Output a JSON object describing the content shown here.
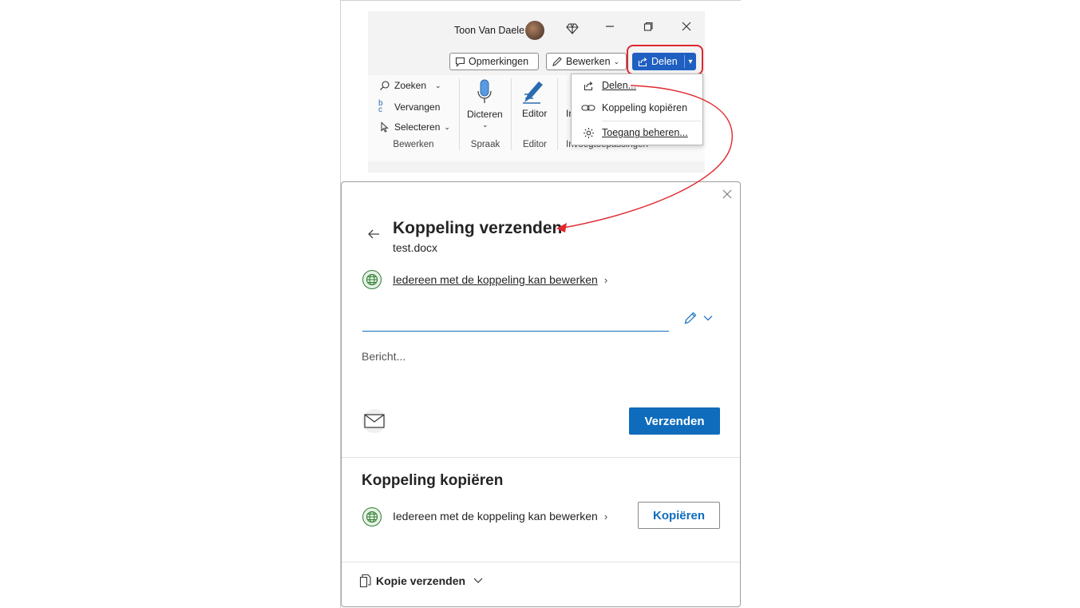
{
  "titlebar": {
    "user_name": "Toon Van Daele",
    "icons": [
      "diamond-icon",
      "minimize-icon",
      "restore-icon",
      "close-icon"
    ]
  },
  "toolbar": {
    "comments_label": "Opmerkingen",
    "editing_label": "Bewerken",
    "share_label": "Delen"
  },
  "ribbon": {
    "find_label": "Zoeken",
    "replace_label": "Vervangen",
    "select_label": "Selecteren",
    "group_editing": "Bewerken",
    "dictate_label": "Dicteren",
    "group_voice": "Spraak",
    "editor_label": "Editor",
    "group_editor": "Editor",
    "addins_partial": "In",
    "group_addins": "Invoegtoepassingen"
  },
  "share_menu": {
    "items": [
      {
        "label": "Delen...",
        "icon": "share-icon"
      },
      {
        "label": "Koppeling kopiëren",
        "icon": "link-icon"
      },
      {
        "label": "Toegang beheren...",
        "icon": "gear-icon"
      }
    ]
  },
  "dialog": {
    "title": "Koppeling verzenden",
    "filename": "test.docx",
    "permission_link": "Iedereen met de koppeling kan bewerken",
    "recipient_placeholder": "",
    "message_placeholder": "Bericht...",
    "send_button": "Verzenden",
    "copy_section_title": "Koppeling kopiëren",
    "copy_permission": "Iedereen met de koppeling kan bewerken",
    "copy_button": "Kopiëren",
    "send_copy_label": "Kopie verzenden"
  },
  "colors": {
    "accent": "#0f6cbd",
    "share_button": "#1f5fc1",
    "annotation_red": "#e0282f",
    "globe_green": "#2f7d32"
  }
}
